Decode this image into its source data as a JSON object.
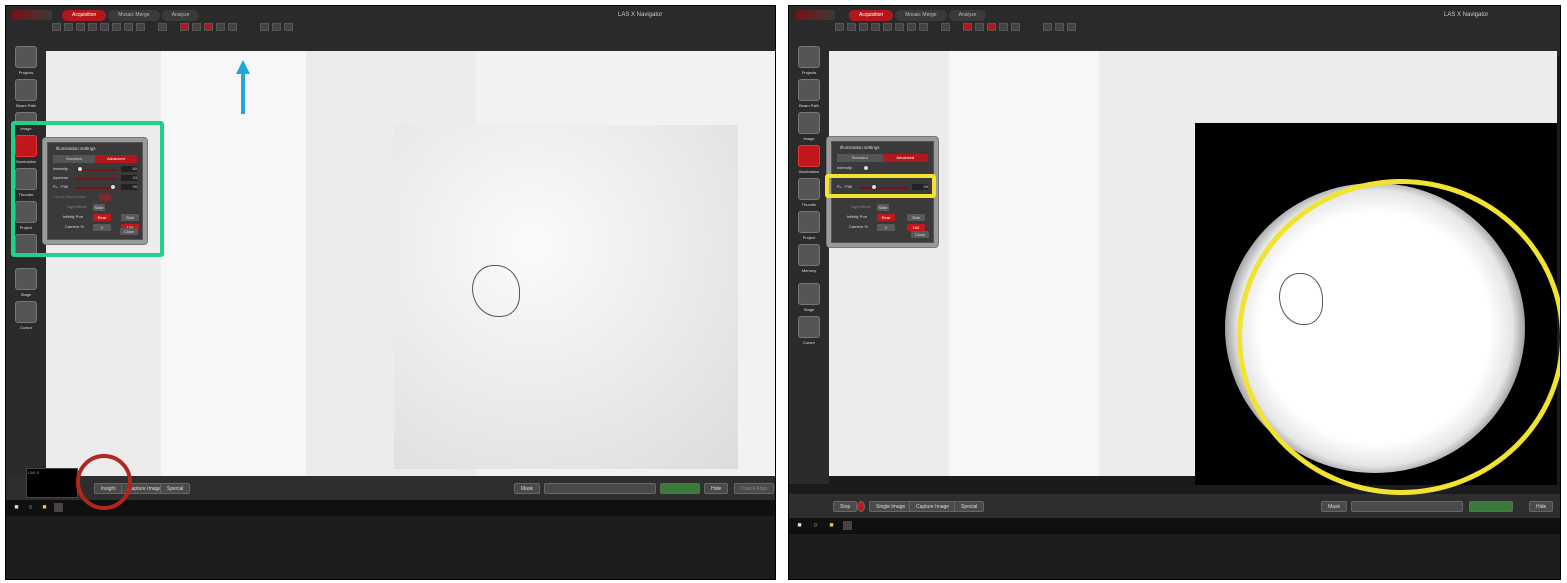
{
  "app": {
    "tabs": [
      "Acquisition",
      "Mosaic Merge",
      "Analyze"
    ],
    "title": "LAS X Navigator"
  },
  "sidebar": {
    "items": [
      "Projects",
      "Beam Path",
      "Image",
      "Illumination",
      "Thunder",
      "Project",
      "Memory",
      "Stage",
      "Cursor"
    ]
  },
  "illumination_panel": {
    "title": "Illumination settings",
    "mode_standard": "Standard",
    "mode_advanced": "Advanced",
    "intensity_label": "Intensity",
    "intensity_value": "80",
    "aperture_label": "Aperture",
    "aperture_value": "24",
    "fl_fim_label": "FL - FIM",
    "fl_fim_value": "55",
    "create_illumination_label": "Create Illumination",
    "light_mode_label": "Light Mode",
    "light_mode_value": "Slide",
    "infinity_port_label": "Infinity Port",
    "infinity_rear": "Rear",
    "infinity_side": "Side",
    "camera_pct_label": "Camera %",
    "camera_0": "0",
    "camera_100": "100",
    "close_label": "Close"
  },
  "bottom_left": {
    "thumb_title": "LAS X",
    "btn_insight": "Insight",
    "btn_capture": "Capture Image",
    "btn_special": "Special",
    "btn_mask": "Mask",
    "btn_hide": "Hide",
    "btn_last": "Check Align"
  },
  "bottom_right": {
    "btn_stop": "Stop",
    "btn_single": "Single Image",
    "btn_capture": "Capture Image",
    "btn_special": "Special",
    "btn_mask": "Mask",
    "btn_hide": "Hide"
  },
  "colors": {
    "accent_red": "#c0181c",
    "annot_green": "#1fd18a",
    "annot_blue": "#1fa7d9",
    "annot_red": "#b3261e",
    "annot_yellow": "#f2e232"
  },
  "icons": {
    "arrow": "arrow-up-icon",
    "windows": "windows-start-icon",
    "search": "search-icon",
    "folder": "folder-icon"
  }
}
